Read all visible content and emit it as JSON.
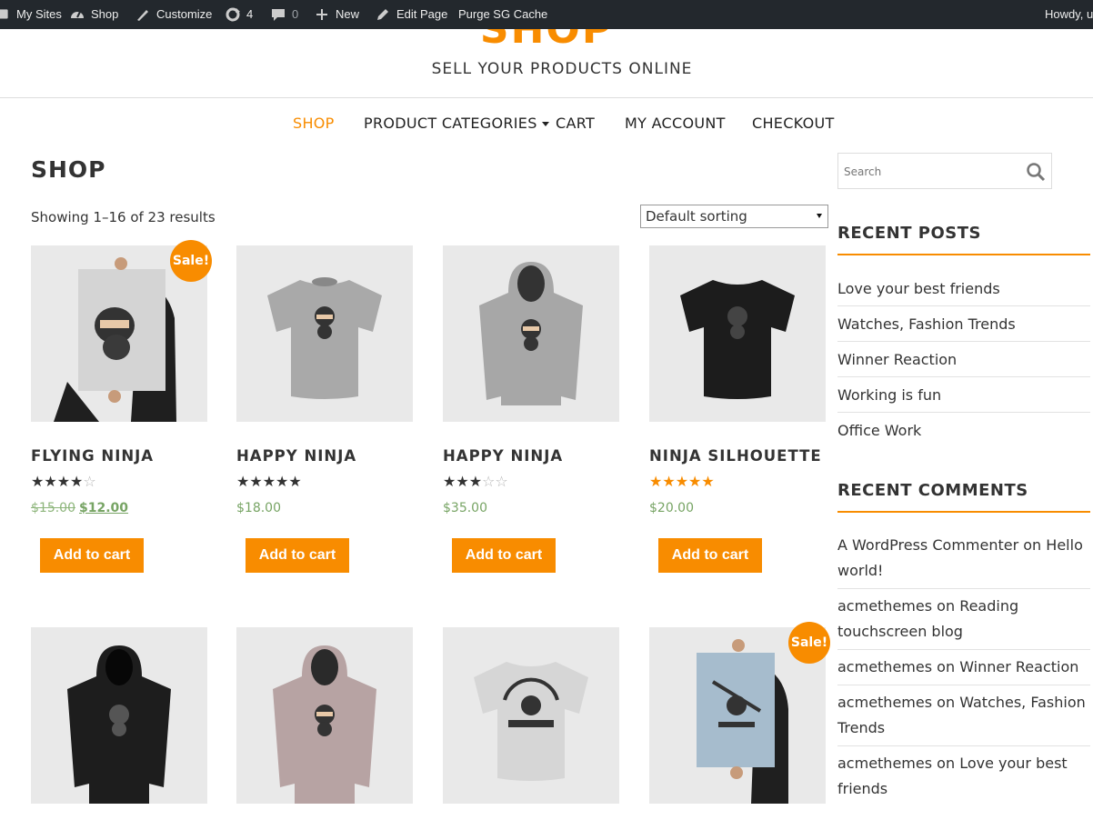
{
  "admin_bar": {
    "my_sites": "My Sites",
    "site": "Shop",
    "customize": "Customize",
    "updates_count": "4",
    "comments_count": "0",
    "new": "New",
    "edit_page": "Edit Page",
    "purge": "Purge SG Cache",
    "howdy": "Howdy, u"
  },
  "header": {
    "site_title": "SHOP",
    "tagline": "SELL YOUR PRODUCTS ONLINE"
  },
  "nav": {
    "items": [
      {
        "label": "SHOP",
        "active": true
      },
      {
        "label": "PRODUCT CATEGORIES",
        "has_dropdown": true
      },
      {
        "label": "CART"
      },
      {
        "label": "MY ACCOUNT"
      },
      {
        "label": "CHECKOUT"
      }
    ]
  },
  "main": {
    "title": "SHOP",
    "result_count": "Showing 1–16 of 23 results",
    "sorting": "Default sorting"
  },
  "products": [
    {
      "name": "FLYING NINJA",
      "rating": 4,
      "old_price": "$15.00",
      "price": "$12.00",
      "sale": true,
      "sale_label": "Sale!",
      "button": "Add to cart",
      "image": "poster-ninja"
    },
    {
      "name": "HAPPY NINJA",
      "rating": 5,
      "price": "$18.00",
      "button": "Add to cart",
      "image": "grey-tshirt"
    },
    {
      "name": "HAPPY NINJA",
      "rating": 3,
      "price": "$35.00",
      "button": "Add to cart",
      "image": "grey-hoodie"
    },
    {
      "name": "NINJA SILHOUETTE",
      "rating": 5,
      "rating_color": "#f88c00",
      "price": "$20.00",
      "button": "Add to cart",
      "image": "black-tshirt"
    },
    {
      "image": "black-hoodie"
    },
    {
      "image": "pink-hoodie"
    },
    {
      "image": "white-tshirt-woothemes"
    },
    {
      "image": "blue-poster-woothemes",
      "sale": true,
      "sale_label": "Sale!"
    }
  ],
  "sidebar": {
    "search_placeholder": "Search",
    "recent_posts_title": "RECENT POSTS",
    "recent_posts": [
      "Love your best friends",
      "Watches, Fashion Trends",
      "Winner Reaction",
      "Working is fun",
      "Office Work"
    ],
    "recent_comments_title": "RECENT COMMENTS",
    "recent_comments": [
      {
        "author": "A WordPress Commenter",
        "on": "on",
        "post": "Hello world!"
      },
      {
        "author": "acmethemes",
        "on": "on",
        "post": "Reading touchscreen blog"
      },
      {
        "author": "acmethemes",
        "on": "on",
        "post": "Winner Reaction"
      },
      {
        "author": "acmethemes",
        "on": "on",
        "post": "Watches, Fashion Trends"
      },
      {
        "author": "acmethemes",
        "on": "on",
        "post": "Love your best friends"
      }
    ]
  },
  "colors": {
    "accent": "#f88c00",
    "price": "#77a464",
    "admin_bar": "#23282d"
  }
}
